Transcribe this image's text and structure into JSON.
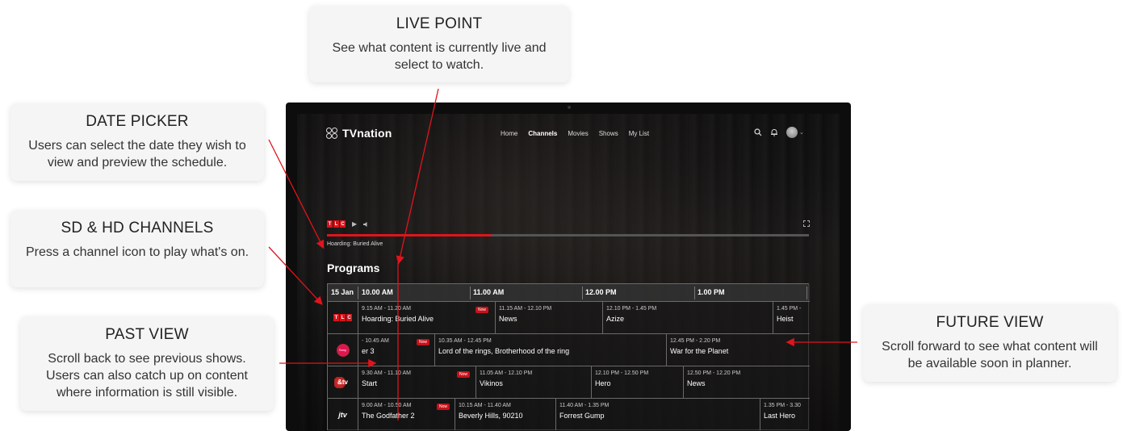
{
  "callouts": {
    "live_point": {
      "title": "LIVE POINT",
      "text": "See what content is currently live and select to watch."
    },
    "date_picker": {
      "title": "DATE PICKER",
      "text": "Users can select the date they wish to view and preview the schedule."
    },
    "channels": {
      "title": "SD & HD CHANNELS",
      "text": "Press a channel icon to play what's on."
    },
    "past_view": {
      "title": "PAST VIEW",
      "text": "Scroll back to see previous shows. Users can also catch up on content where information is still visible."
    },
    "future_view": {
      "title": "FUTURE VIEW",
      "text": "Scroll forward to see what content will be available soon in planner."
    }
  },
  "app": {
    "brand": "TVnation",
    "nav": [
      "Home",
      "Channels",
      "Movies",
      "Shows",
      "My List"
    ],
    "active_nav": "Channels",
    "icons": [
      "search-icon",
      "bell-icon",
      "avatar",
      "chevron-down-icon"
    ]
  },
  "player": {
    "channel_logo": [
      "T",
      "L",
      "C"
    ],
    "now_playing": "Hoarding: Buried Alive",
    "progress": 0.34
  },
  "programs": {
    "title": "Programs",
    "date": "15 Jan",
    "times": [
      "10.00 AM",
      "11.00 AM",
      "12.00 PM",
      "1.00 PM"
    ],
    "now_badge": "Now",
    "rows": [
      {
        "channel": "TLC",
        "shows": [
          {
            "time": "9.15 AM - 11.20 AM",
            "name": "Hoarding: Buried Alive",
            "now": true
          },
          {
            "time": "11.15 AM - 12.10 PM",
            "name": "News"
          },
          {
            "time": "12.10 PM - 1.45 PM",
            "name": "Azize"
          },
          {
            "time": "1.45 PM -",
            "name": "Heist"
          }
        ]
      },
      {
        "channel": "Sony",
        "shows": [
          {
            "time": "- 10.45 AM",
            "name": "er 3"
          },
          {
            "time": "10.35 AM - 12.45 PM",
            "name": "Lord of the rings, Brotherhood of the ring",
            "now": true
          },
          {
            "time": "12.45 PM - 2.20 PM",
            "name": "War for the Planet"
          }
        ]
      },
      {
        "channel": "&tv",
        "shows": [
          {
            "time": "9.30 AM - 11.10 AM",
            "name": "Start"
          },
          {
            "time": "11.05 AM - 12.10 PM",
            "name": "Vikinos",
            "now": true
          },
          {
            "time": "12.10 PM - 12.50 PM",
            "name": "Hero"
          },
          {
            "time": "12.50 PM - 12.20 PM",
            "name": "News"
          }
        ]
      },
      {
        "channel": "jtv",
        "shows": [
          {
            "time": "9.00 AM - 10.50 AM",
            "name": "The Godfather 2",
            "now": true
          },
          {
            "time": "10.15 AM - 11.40 AM",
            "name": "Beverly Hills, 90210"
          },
          {
            "time": "11.40 AM - 1.35 PM",
            "name": "Forrest Gump"
          },
          {
            "time": "1.35 PM - 3.30",
            "name": "Last Hero"
          }
        ]
      }
    ]
  },
  "colors": {
    "accent": "#e0141c",
    "arrow": "#e0141c",
    "callout_bg": "#f5f5f5"
  }
}
